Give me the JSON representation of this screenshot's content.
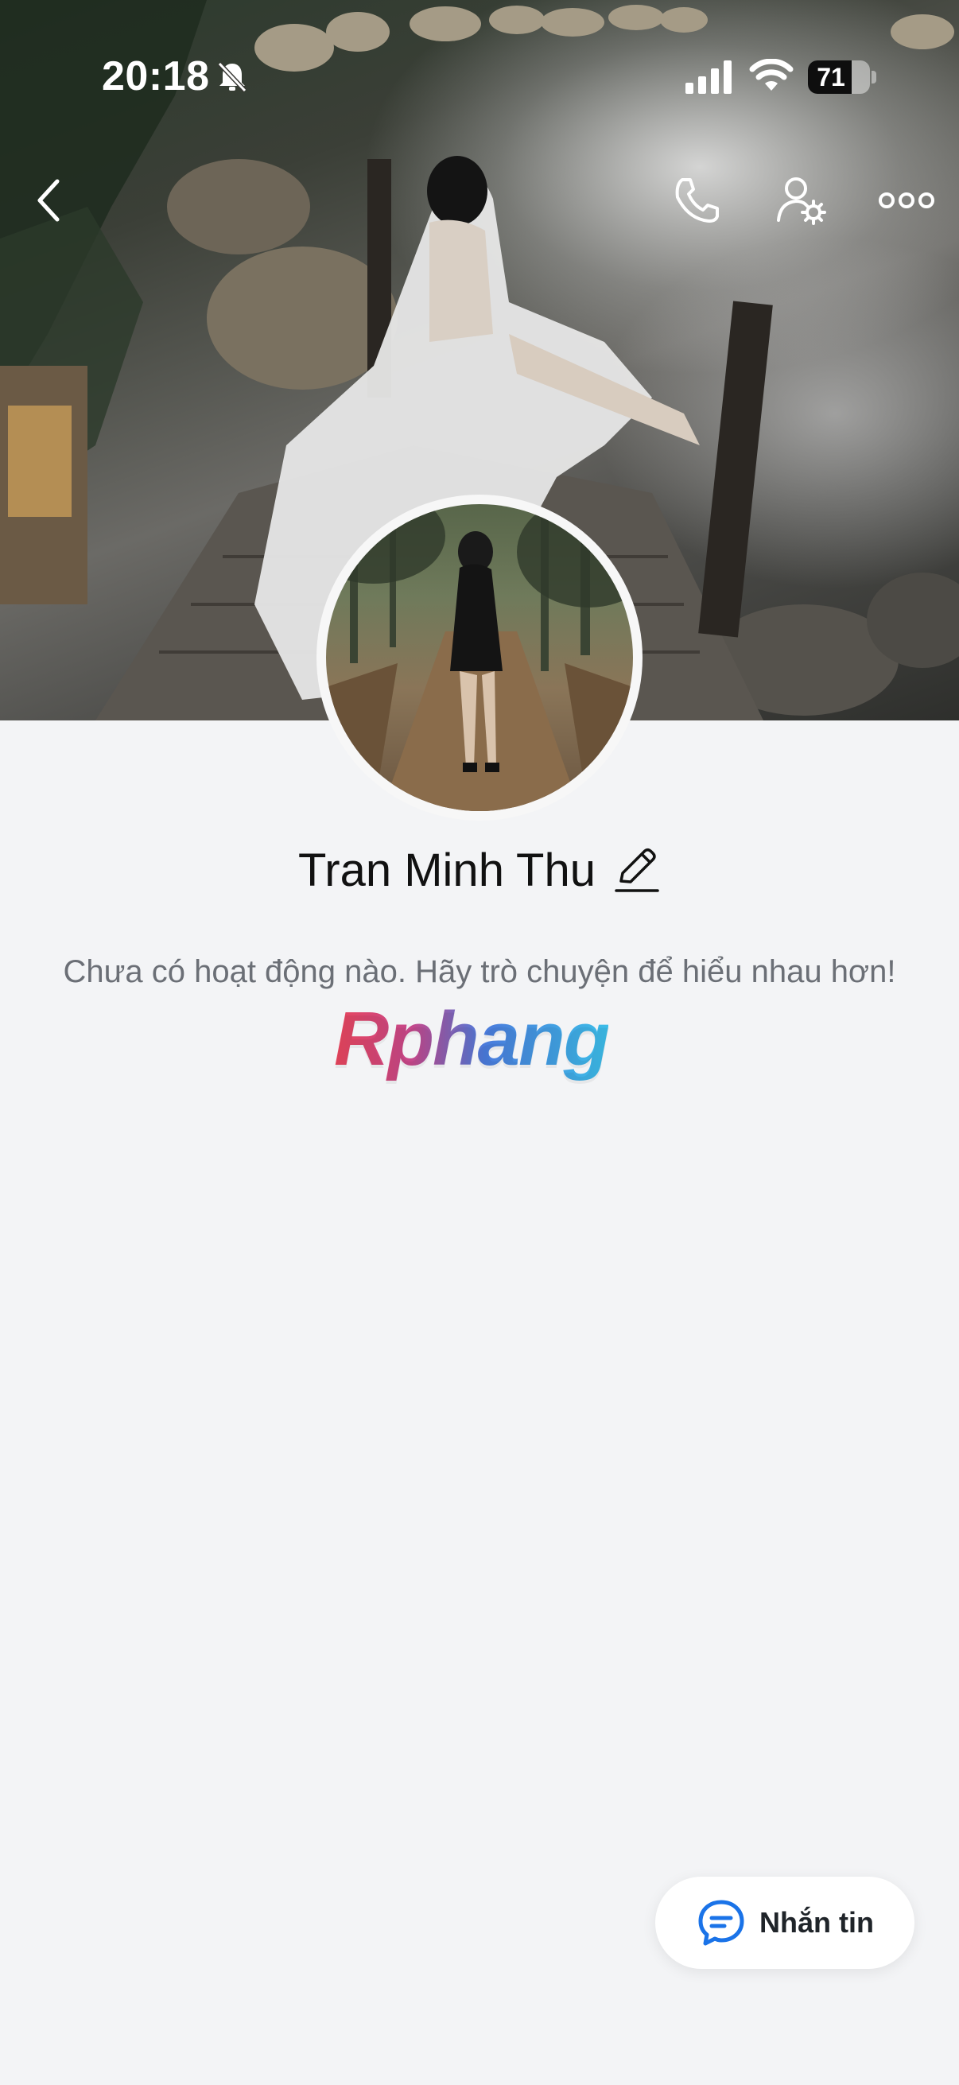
{
  "status_bar": {
    "time": "20:18",
    "battery_level": "71",
    "battery_fraction": 0.71
  },
  "header": {
    "back_icon": "chevron-left-icon",
    "call_icon": "phone-icon",
    "settings_icon": "user-gear-icon",
    "more_icon": "ellipsis-icon"
  },
  "profile": {
    "name": "Tran Minh Thu",
    "edit_icon": "pencil-icon",
    "empty_message": "Chưa có hoạt động nào. Hãy trò chuyện để hiểu nhau hơn!"
  },
  "watermark": {
    "text": "Rphang"
  },
  "actions": {
    "message_label": "Nhắn tin",
    "message_icon": "chat-bubble-icon"
  },
  "colors": {
    "accent": "#1a73e8",
    "background": "#f3f4f6",
    "text_primary": "#111111",
    "text_secondary": "#6b6f76"
  }
}
